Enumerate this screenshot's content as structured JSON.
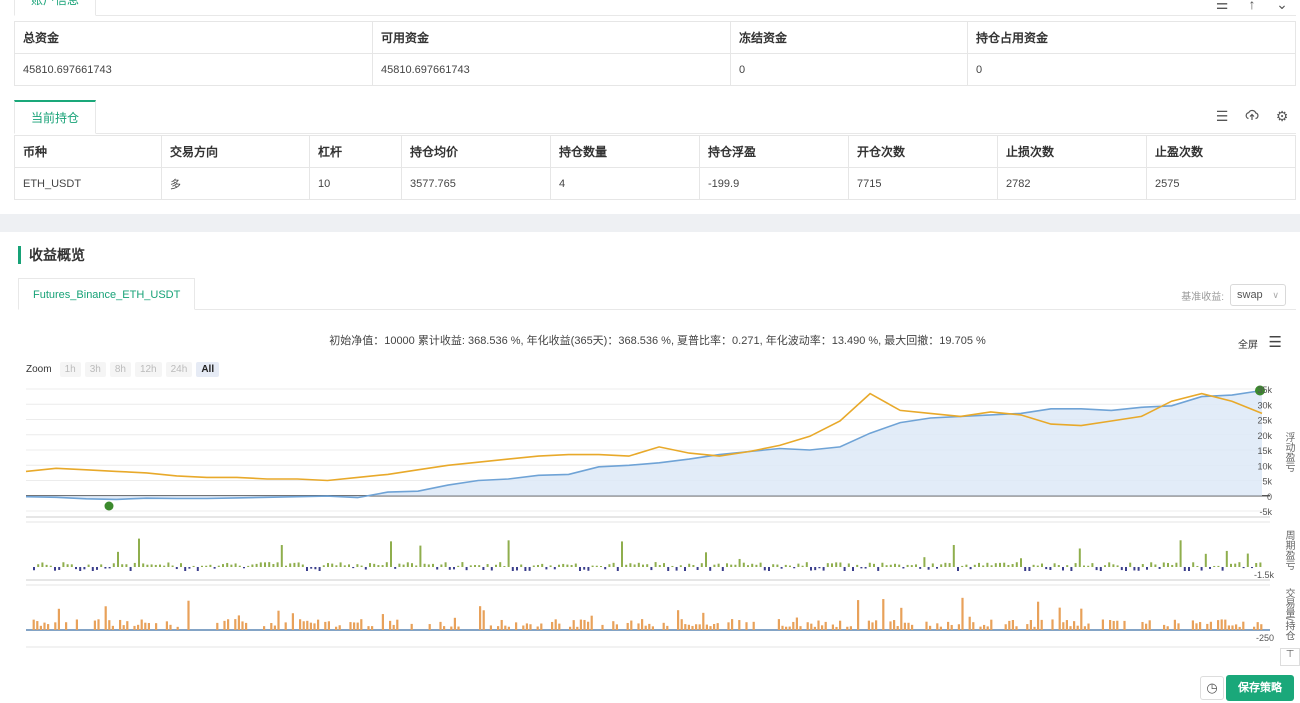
{
  "account": {
    "tab_label": "账户信息",
    "columns": [
      "总资金",
      "可用资金",
      "冻结资金",
      "持仓占用资金"
    ],
    "row": [
      "45810.697661743",
      "45810.697661743",
      "0",
      "0"
    ]
  },
  "positions": {
    "tab_label": "当前持仓",
    "columns": [
      "币种",
      "交易方向",
      "杠杆",
      "持仓均价",
      "持仓数量",
      "持仓浮盈",
      "开仓次数",
      "止损次数",
      "止盈次数"
    ],
    "row": [
      "ETH_USDT",
      "多",
      "10",
      "3577.765",
      "4",
      "-199.9",
      "7715",
      "2782",
      "2575"
    ]
  },
  "toolbar_icons": [
    "list-icon",
    "cloud-upload-icon",
    "gear-icon"
  ],
  "overview": {
    "title": "收益概览",
    "tab": "Futures_Binance_ETH_USDT",
    "base_label": "基准收益:",
    "base_value": "swap",
    "summary": "初始净值：10000 累计收益: 368.536 %, 年化收益(365天)：368.536 %, 夏普比率：0.271, 年化波动率：13.490 %, 最大回撤：19.705 %",
    "fullscreen": "全屏",
    "zoom_label": "Zoom",
    "zoom_buttons": [
      "1h",
      "3h",
      "8h",
      "12h",
      "24h",
      "All"
    ],
    "zoom_active": "All"
  },
  "actions": {
    "save": "保存策略"
  },
  "colors": {
    "accent": "#17a277",
    "equity_line": "#6fa3d6",
    "equity_fill": "#dde9f7",
    "benchmark_line": "#e8a92a",
    "pnl_pos": "#8fae4d",
    "pnl_neg": "#3b3f8c",
    "volume": "#e8a15a"
  },
  "chart_data": {
    "type": "line",
    "main": {
      "y_axis_title": "浮动盈亏",
      "y_ticks": [
        "35k",
        "30k",
        "25k",
        "20k",
        "15k",
        "10k",
        "5k",
        "0",
        "-5k"
      ],
      "ylim": [
        -5000,
        35000
      ],
      "series": [
        {
          "values": [
            -300,
            -500,
            -1000,
            -1200,
            -800,
            -900,
            -900,
            -700,
            -500,
            -300,
            -100,
            -600,
            1200,
            1500,
            3500,
            5000,
            5500,
            6700,
            7000,
            9500,
            10000,
            10800,
            12000,
            13500,
            14500,
            15500,
            15000,
            16000,
            20500,
            24000,
            25500,
            26000,
            26500,
            27000,
            28500,
            28500,
            28000,
            29000,
            29500,
            32500,
            33000,
            34500
          ]
        },
        {
          "values": [
            8000,
            9000,
            8500,
            8000,
            7500,
            6500,
            6000,
            6000,
            5500,
            5500,
            5000,
            6000,
            7000,
            8500,
            10000,
            11000,
            12000,
            13000,
            13500,
            13500,
            13000,
            16000,
            14000,
            13000,
            14500,
            16500,
            19500,
            24500,
            33500,
            28000,
            27000,
            26000,
            27500,
            26500,
            23500,
            23000,
            24500,
            26000,
            31000,
            33500,
            31000,
            27000
          ]
        }
      ]
    },
    "pnl": {
      "y_axis_title": "周期盈亏",
      "y_ticks": [
        "-1.5k"
      ]
    },
    "volume": {
      "y_axis_title": "交易量/持仓",
      "y_ticks": [
        "-250"
      ]
    }
  }
}
